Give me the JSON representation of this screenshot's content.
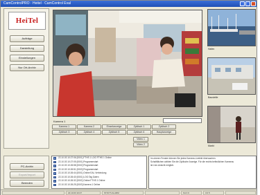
{
  "window": {
    "title": "CamControlPRO · Heitel · CamControl Eval"
  },
  "branding": {
    "logo_text": "HeiTel"
  },
  "sidebar": {
    "buttons": [
      "Aufträge",
      "Darstellung",
      "Einstellungen",
      "Nur Ort-Archiv"
    ]
  },
  "main_view": {
    "camera_label": "Kamera 1",
    "grid_buttons_row1": [
      "Kamera 1",
      "Kamera 2",
      "Einzelanzeige",
      "Zyklisch 1",
      "Zyklisch 2"
    ],
    "grid_buttons_row2": [
      "Zyklisch 3",
      "Zyklisch 4",
      "Zyklisch 5",
      "Zyklisch 6",
      "Hauptanzeige"
    ],
    "small_buttons": [
      "Video 1",
      "Video 2"
    ]
  },
  "thumbnails": {
    "labels": [
      "Hafen",
      "Baustelle",
      "Markt"
    ]
  },
  "bottom_left": {
    "buttons": [
      "PC-Archiv",
      "Export/Import",
      "Beenden"
    ]
  },
  "log": {
    "rows": [
      "22.10.03 10:27:06  [0001] FTHS 1 LOG FTHS 1 Online",
      "22.10.03 10:27:05  [0001] Programmstart",
      "22.10.03 10:26:58  [0002] Programmstart",
      "22.10.03 10:26:51  [0003] Programmstart",
      "22.10.03 10:26:44  [0001] Online EAL Verbindung",
      "22.10.03 10:26:40  [0001] LOG:Tag Daten",
      "22.10.03 10:26:32  [0002] Online FTHS 1 Online",
      "22.10.03 10:26:25  [0003] Kamera 1 Online"
    ]
  },
  "info": {
    "lines": [
      "Im oberen Fenster können Sie jedes Kamera-Livebild überwachen.",
      "Schaltflächen wählen Sie die Zyklische Anzeige. Für die rechts befindlichen Kameras",
      "ist Live-Ansicht möglich."
    ]
  },
  "statusbar": {
    "cells": [
      "",
      "22.10.03 10:27",
      "ST/AT 5  ALARM",
      "",
      "KA 0 0",
      "3.0 5",
      ""
    ]
  },
  "colors": {
    "titlebar": "#1f4fb5",
    "logo_red": "#c81e1e",
    "panel_bg": "#ece9d8"
  }
}
